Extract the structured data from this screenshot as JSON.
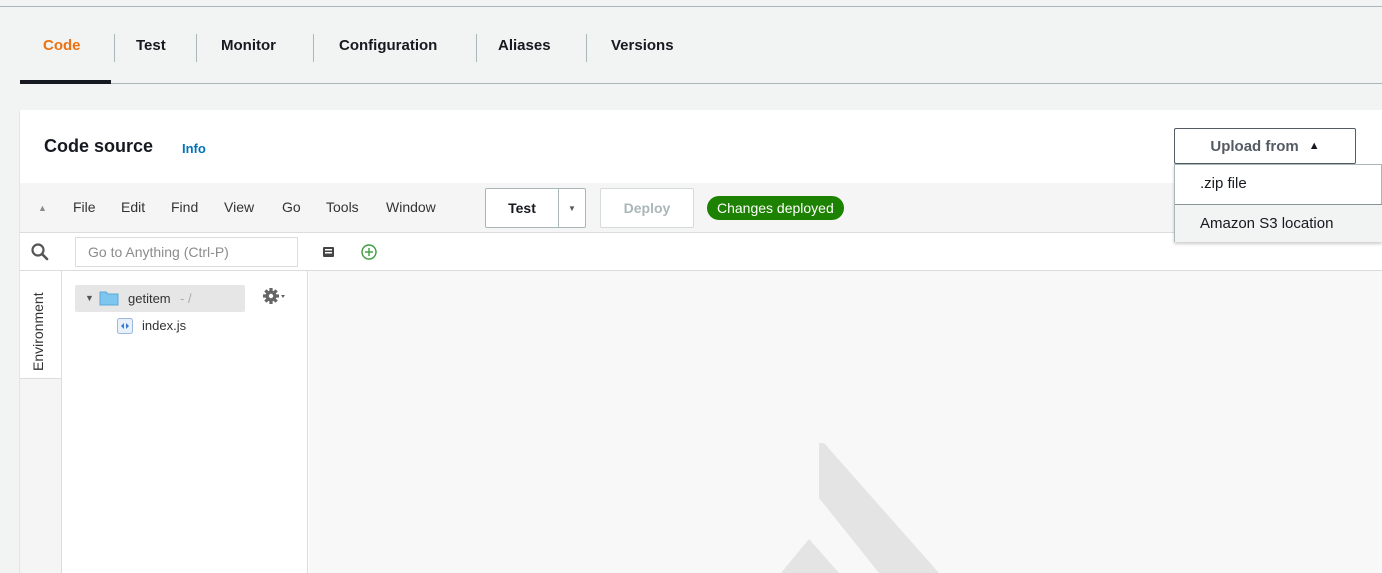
{
  "tabs": [
    {
      "label": "Code",
      "active": true
    },
    {
      "label": "Test"
    },
    {
      "label": "Monitor"
    },
    {
      "label": "Configuration"
    },
    {
      "label": "Aliases"
    },
    {
      "label": "Versions"
    }
  ],
  "panel": {
    "title": "Code source",
    "info": "Info",
    "upload_label": "Upload from",
    "upload_caret": "▲",
    "upload_options": [
      ".zip file",
      "Amazon S3 location"
    ]
  },
  "ide": {
    "menu": [
      "File",
      "Edit",
      "Find",
      "View",
      "Go",
      "Tools",
      "Window"
    ],
    "test_label": "Test",
    "deploy_label": "Deploy",
    "status_badge": "Changes deployed",
    "search_placeholder": "Go to Anything (Ctrl-P)",
    "side_tab": "Environment",
    "folder_name": "getitem",
    "folder_path": "- /",
    "files": [
      "index.js"
    ]
  },
  "colors": {
    "active_tab": "#ec7211",
    "link": "#0073bb",
    "badge": "#1d8102",
    "folder": "#7dc6f0"
  }
}
